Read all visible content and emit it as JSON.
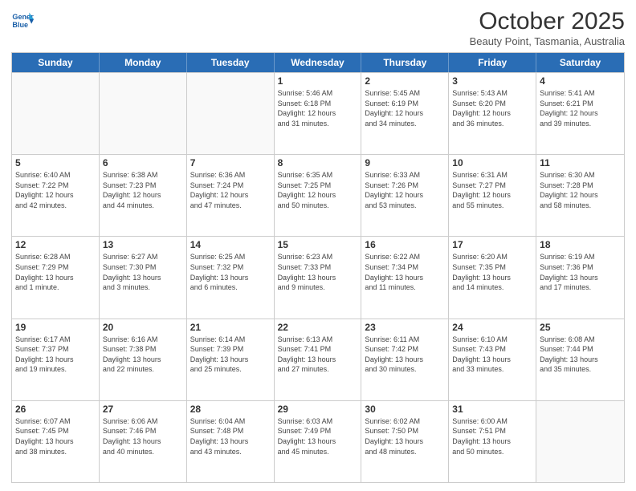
{
  "header": {
    "logo_line1": "General",
    "logo_line2": "Blue",
    "month": "October 2025",
    "location": "Beauty Point, Tasmania, Australia"
  },
  "day_headers": [
    "Sunday",
    "Monday",
    "Tuesday",
    "Wednesday",
    "Thursday",
    "Friday",
    "Saturday"
  ],
  "weeks": [
    [
      {
        "num": "",
        "info": ""
      },
      {
        "num": "",
        "info": ""
      },
      {
        "num": "",
        "info": ""
      },
      {
        "num": "1",
        "info": "Sunrise: 5:46 AM\nSunset: 6:18 PM\nDaylight: 12 hours\nand 31 minutes."
      },
      {
        "num": "2",
        "info": "Sunrise: 5:45 AM\nSunset: 6:19 PM\nDaylight: 12 hours\nand 34 minutes."
      },
      {
        "num": "3",
        "info": "Sunrise: 5:43 AM\nSunset: 6:20 PM\nDaylight: 12 hours\nand 36 minutes."
      },
      {
        "num": "4",
        "info": "Sunrise: 5:41 AM\nSunset: 6:21 PM\nDaylight: 12 hours\nand 39 minutes."
      }
    ],
    [
      {
        "num": "5",
        "info": "Sunrise: 6:40 AM\nSunset: 7:22 PM\nDaylight: 12 hours\nand 42 minutes."
      },
      {
        "num": "6",
        "info": "Sunrise: 6:38 AM\nSunset: 7:23 PM\nDaylight: 12 hours\nand 44 minutes."
      },
      {
        "num": "7",
        "info": "Sunrise: 6:36 AM\nSunset: 7:24 PM\nDaylight: 12 hours\nand 47 minutes."
      },
      {
        "num": "8",
        "info": "Sunrise: 6:35 AM\nSunset: 7:25 PM\nDaylight: 12 hours\nand 50 minutes."
      },
      {
        "num": "9",
        "info": "Sunrise: 6:33 AM\nSunset: 7:26 PM\nDaylight: 12 hours\nand 53 minutes."
      },
      {
        "num": "10",
        "info": "Sunrise: 6:31 AM\nSunset: 7:27 PM\nDaylight: 12 hours\nand 55 minutes."
      },
      {
        "num": "11",
        "info": "Sunrise: 6:30 AM\nSunset: 7:28 PM\nDaylight: 12 hours\nand 58 minutes."
      }
    ],
    [
      {
        "num": "12",
        "info": "Sunrise: 6:28 AM\nSunset: 7:29 PM\nDaylight: 13 hours\nand 1 minute."
      },
      {
        "num": "13",
        "info": "Sunrise: 6:27 AM\nSunset: 7:30 PM\nDaylight: 13 hours\nand 3 minutes."
      },
      {
        "num": "14",
        "info": "Sunrise: 6:25 AM\nSunset: 7:32 PM\nDaylight: 13 hours\nand 6 minutes."
      },
      {
        "num": "15",
        "info": "Sunrise: 6:23 AM\nSunset: 7:33 PM\nDaylight: 13 hours\nand 9 minutes."
      },
      {
        "num": "16",
        "info": "Sunrise: 6:22 AM\nSunset: 7:34 PM\nDaylight: 13 hours\nand 11 minutes."
      },
      {
        "num": "17",
        "info": "Sunrise: 6:20 AM\nSunset: 7:35 PM\nDaylight: 13 hours\nand 14 minutes."
      },
      {
        "num": "18",
        "info": "Sunrise: 6:19 AM\nSunset: 7:36 PM\nDaylight: 13 hours\nand 17 minutes."
      }
    ],
    [
      {
        "num": "19",
        "info": "Sunrise: 6:17 AM\nSunset: 7:37 PM\nDaylight: 13 hours\nand 19 minutes."
      },
      {
        "num": "20",
        "info": "Sunrise: 6:16 AM\nSunset: 7:38 PM\nDaylight: 13 hours\nand 22 minutes."
      },
      {
        "num": "21",
        "info": "Sunrise: 6:14 AM\nSunset: 7:39 PM\nDaylight: 13 hours\nand 25 minutes."
      },
      {
        "num": "22",
        "info": "Sunrise: 6:13 AM\nSunset: 7:41 PM\nDaylight: 13 hours\nand 27 minutes."
      },
      {
        "num": "23",
        "info": "Sunrise: 6:11 AM\nSunset: 7:42 PM\nDaylight: 13 hours\nand 30 minutes."
      },
      {
        "num": "24",
        "info": "Sunrise: 6:10 AM\nSunset: 7:43 PM\nDaylight: 13 hours\nand 33 minutes."
      },
      {
        "num": "25",
        "info": "Sunrise: 6:08 AM\nSunset: 7:44 PM\nDaylight: 13 hours\nand 35 minutes."
      }
    ],
    [
      {
        "num": "26",
        "info": "Sunrise: 6:07 AM\nSunset: 7:45 PM\nDaylight: 13 hours\nand 38 minutes."
      },
      {
        "num": "27",
        "info": "Sunrise: 6:06 AM\nSunset: 7:46 PM\nDaylight: 13 hours\nand 40 minutes."
      },
      {
        "num": "28",
        "info": "Sunrise: 6:04 AM\nSunset: 7:48 PM\nDaylight: 13 hours\nand 43 minutes."
      },
      {
        "num": "29",
        "info": "Sunrise: 6:03 AM\nSunset: 7:49 PM\nDaylight: 13 hours\nand 45 minutes."
      },
      {
        "num": "30",
        "info": "Sunrise: 6:02 AM\nSunset: 7:50 PM\nDaylight: 13 hours\nand 48 minutes."
      },
      {
        "num": "31",
        "info": "Sunrise: 6:00 AM\nSunset: 7:51 PM\nDaylight: 13 hours\nand 50 minutes."
      },
      {
        "num": "",
        "info": ""
      }
    ]
  ]
}
